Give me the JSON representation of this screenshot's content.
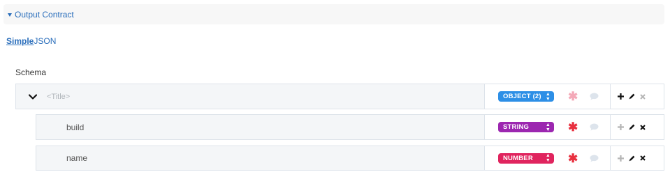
{
  "section": {
    "title": "Output Contract"
  },
  "mode": {
    "simple": "Simple",
    "json": "JSON"
  },
  "schema": {
    "label": "Schema",
    "root": {
      "placeholder": "<Title>",
      "type": "OBJECT (2)",
      "type_color": "#2d8fe6",
      "required_color": "#f4a9b8"
    },
    "fields": [
      {
        "name": "build",
        "type": "STRING",
        "type_color": "#9c27b0",
        "required_color": "#e8303f"
      },
      {
        "name": "name",
        "type": "NUMBER",
        "type_color": "#e0245e",
        "required_color": "#e8303f"
      }
    ]
  },
  "colors": {
    "link": "#2a6ebb",
    "comment": "#dde4ec",
    "action_dark": "#111111",
    "action_muted": "#b5b5b5"
  },
  "icons": {
    "collapse": "caret-down-icon",
    "expand": "chevron-down-icon",
    "required": "asterisk-icon",
    "comment": "comment-icon",
    "add": "plus-icon",
    "edit": "pencil-icon",
    "delete": "close-icon"
  }
}
